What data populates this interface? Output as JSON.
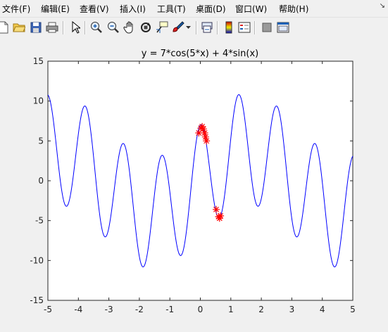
{
  "menu": {
    "items": [
      "文件(F)",
      "编辑(E)",
      "查看(V)",
      "插入(I)",
      "工具(T)",
      "桌面(D)",
      "窗口(W)",
      "帮助(H)"
    ],
    "arrow_glyph": "↘"
  },
  "toolbar": {
    "icons": [
      "new-file-icon",
      "open-folder-icon",
      "save-icon",
      "print-icon",
      "select-arrow-icon",
      "zoom-in-icon",
      "zoom-out-icon",
      "pan-hand-icon",
      "rotate-3d-icon",
      "data-cursor-icon",
      "brush-icon",
      "link-plot-icon",
      "insert-colorbar-icon",
      "insert-legend-icon",
      "hide-plot-tools-icon",
      "show-plot-tools-icon"
    ]
  },
  "chart_data": {
    "type": "line",
    "title": "y = 7*cos(5*x) + 4*sin(x)",
    "xlabel": "",
    "ylabel": "",
    "xlim": [
      -5,
      5
    ],
    "ylim": [
      -15,
      15
    ],
    "xticks": [
      "-5",
      "-4",
      "-3",
      "-2",
      "-1",
      "0",
      "1",
      "2",
      "3",
      "4",
      "5"
    ],
    "yticks": [
      "-15",
      "-10",
      "-5",
      "0",
      "5",
      "10",
      "15"
    ],
    "xtick_values": [
      -5,
      -4,
      -3,
      -2,
      -1,
      0,
      1,
      2,
      3,
      4,
      5
    ],
    "ytick_values": [
      -15,
      -10,
      -5,
      0,
      5,
      10,
      15
    ],
    "series": [
      {
        "style": "line",
        "color": "#0000ff",
        "function": "7*cos(5*x) + 4*sin(x)",
        "x_range": [
          -5,
          5
        ]
      },
      {
        "style": "marker-star",
        "color": "#ff0000",
        "x": [
          -0.05,
          0.02,
          0.06,
          0.1,
          0.14,
          0.17,
          0.2,
          0.52,
          0.6,
          0.63,
          0.66
        ],
        "y": [
          6.0,
          6.6,
          6.8,
          6.5,
          6.0,
          5.5,
          5.0,
          -3.6,
          -4.5,
          -4.7,
          -4.4
        ]
      }
    ],
    "grid": false
  }
}
